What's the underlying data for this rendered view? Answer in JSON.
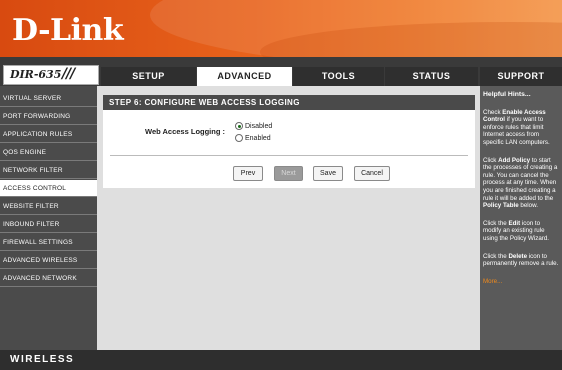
{
  "header": {
    "logo_text": "D-Link"
  },
  "model": {
    "name": "DIR-635",
    "slashes": "///"
  },
  "tabs": [
    {
      "label": "SETUP"
    },
    {
      "label": "ADVANCED"
    },
    {
      "label": "TOOLS"
    },
    {
      "label": "STATUS"
    },
    {
      "label": "SUPPORT"
    }
  ],
  "active_tab": "ADVANCED",
  "sidebar": {
    "items": [
      {
        "label": "VIRTUAL SERVER"
      },
      {
        "label": "PORT FORWARDING"
      },
      {
        "label": "APPLICATION RULES"
      },
      {
        "label": "QOS ENGINE"
      },
      {
        "label": "NETWORK FILTER"
      },
      {
        "label": "ACCESS CONTROL"
      },
      {
        "label": "WEBSITE FILTER"
      },
      {
        "label": "INBOUND FILTER"
      },
      {
        "label": "FIREWALL SETTINGS"
      },
      {
        "label": "ADVANCED WIRELESS"
      },
      {
        "label": "ADVANCED NETWORK"
      }
    ],
    "active_item": "ACCESS CONTROL"
  },
  "main": {
    "panel_title": "STEP 6: CONFIGURE WEB ACCESS LOGGING",
    "field_label": "Web Access Logging :",
    "options": [
      {
        "label": "Disabled",
        "checked": true
      },
      {
        "label": "Enabled",
        "checked": false
      }
    ],
    "buttons": {
      "prev": "Prev",
      "next": "Next",
      "save": "Save",
      "cancel": "Cancel"
    }
  },
  "hints": {
    "title": "Helpful Hints...",
    "p1_pre": "Check ",
    "p1_bold": "Enable Access Control",
    "p1_post": " if you want to enforce rules that limit Internet access from specific LAN computers.",
    "p2_pre": "Click ",
    "p2_bold": "Add Policy",
    "p2_mid": " to start the processes of creating a rule. You can cancel the process at any time. When you are finished creating a rule it will be added to the ",
    "p2_bold2": "Policy Table",
    "p2_post": " below.",
    "p3_pre": "Click the ",
    "p3_bold": "Edit",
    "p3_post": " icon to modify an existing rule using the Policy Wizard.",
    "p4_pre": "Click the ",
    "p4_bold": "Delete",
    "p4_post": " icon to permanently remove a rule.",
    "more": "More..."
  },
  "footer": {
    "text": "WIRELESS"
  },
  "colors": {
    "header_orange": "#e8631c",
    "nav_dark": "#4b4b4b",
    "hint_more": "#f28a1a"
  }
}
